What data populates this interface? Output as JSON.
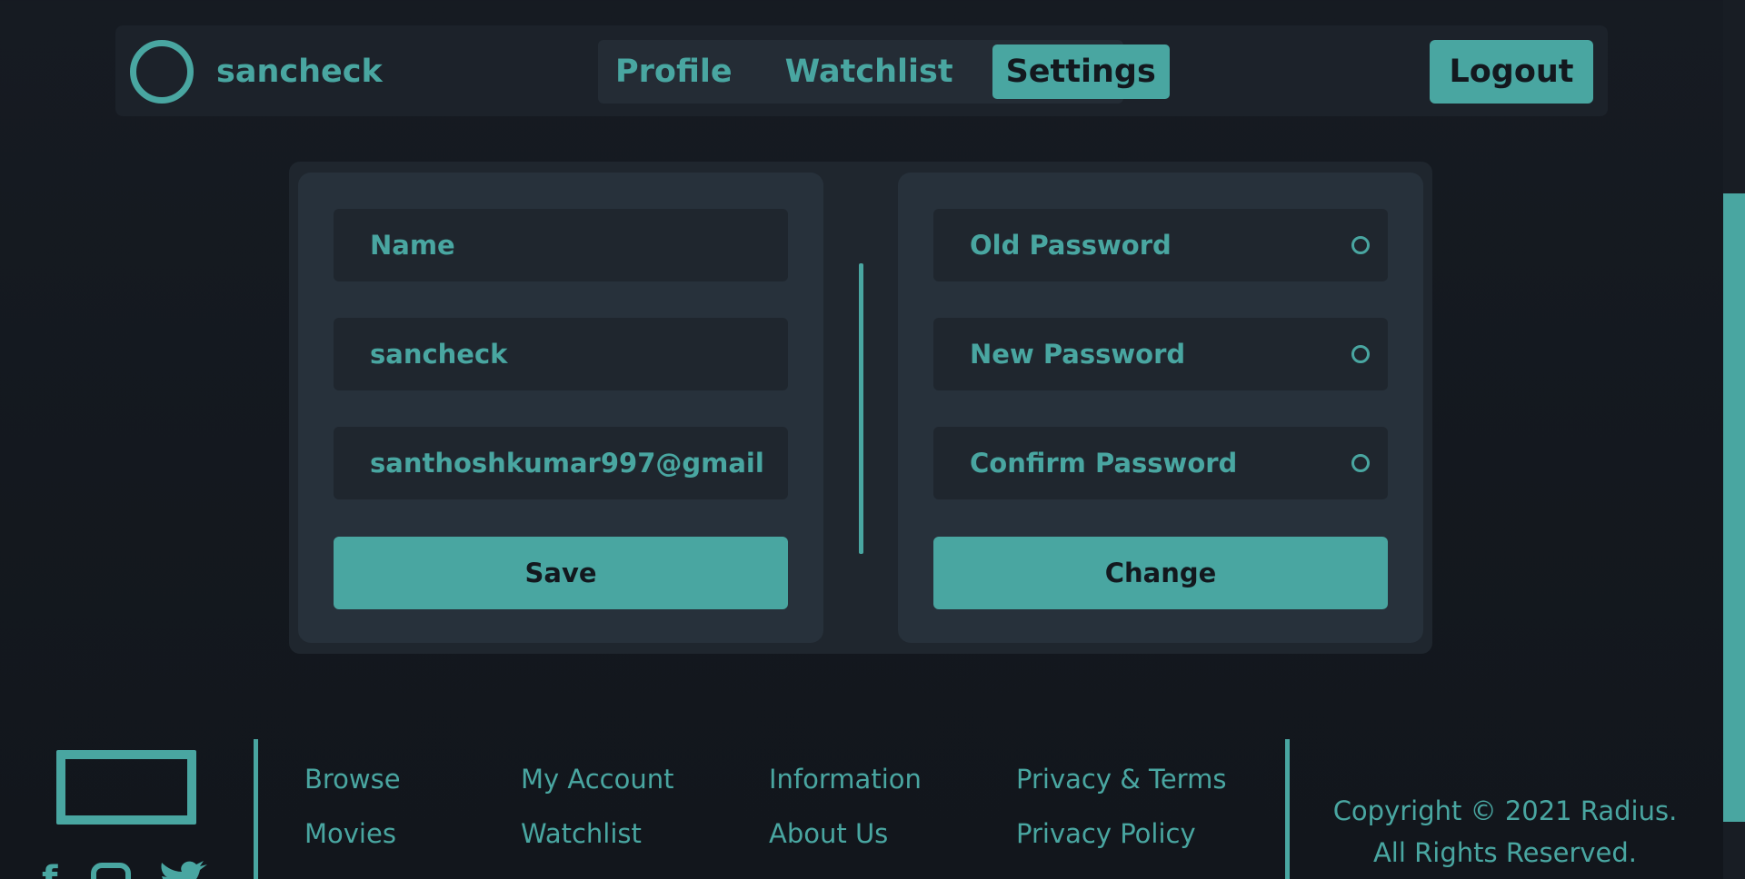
{
  "header": {
    "username": "sancheck",
    "tabs": [
      {
        "label": "Profile",
        "active": false
      },
      {
        "label": "Watchlist",
        "active": false
      },
      {
        "label": "Settings",
        "active": true
      }
    ],
    "logout_label": "Logout"
  },
  "profile_form": {
    "name_placeholder": "Name",
    "username_value": "sancheck",
    "email_value": "santhoshkumar997@gmail",
    "save_label": "Save"
  },
  "password_form": {
    "old_password_placeholder": "Old Password",
    "new_password_placeholder": "New Password",
    "confirm_password_placeholder": "Confirm Password",
    "change_label": "Change"
  },
  "footer": {
    "columns": [
      [
        "Browse",
        "Movies"
      ],
      [
        "My Account",
        "Watchlist"
      ],
      [
        "Information",
        "About Us"
      ],
      [
        "Privacy & Terms",
        "Privacy Policy"
      ]
    ],
    "social_icons": [
      "facebook-icon",
      "instagram-icon",
      "twitter-icon"
    ],
    "copyright_line1": "Copyright © 2021 Radius.",
    "copyright_line2": "All Rights Reserved."
  },
  "colors": {
    "accent": "#49a6a1",
    "background": "#161b22",
    "panel": "#27313b",
    "field": "#1f262e"
  }
}
